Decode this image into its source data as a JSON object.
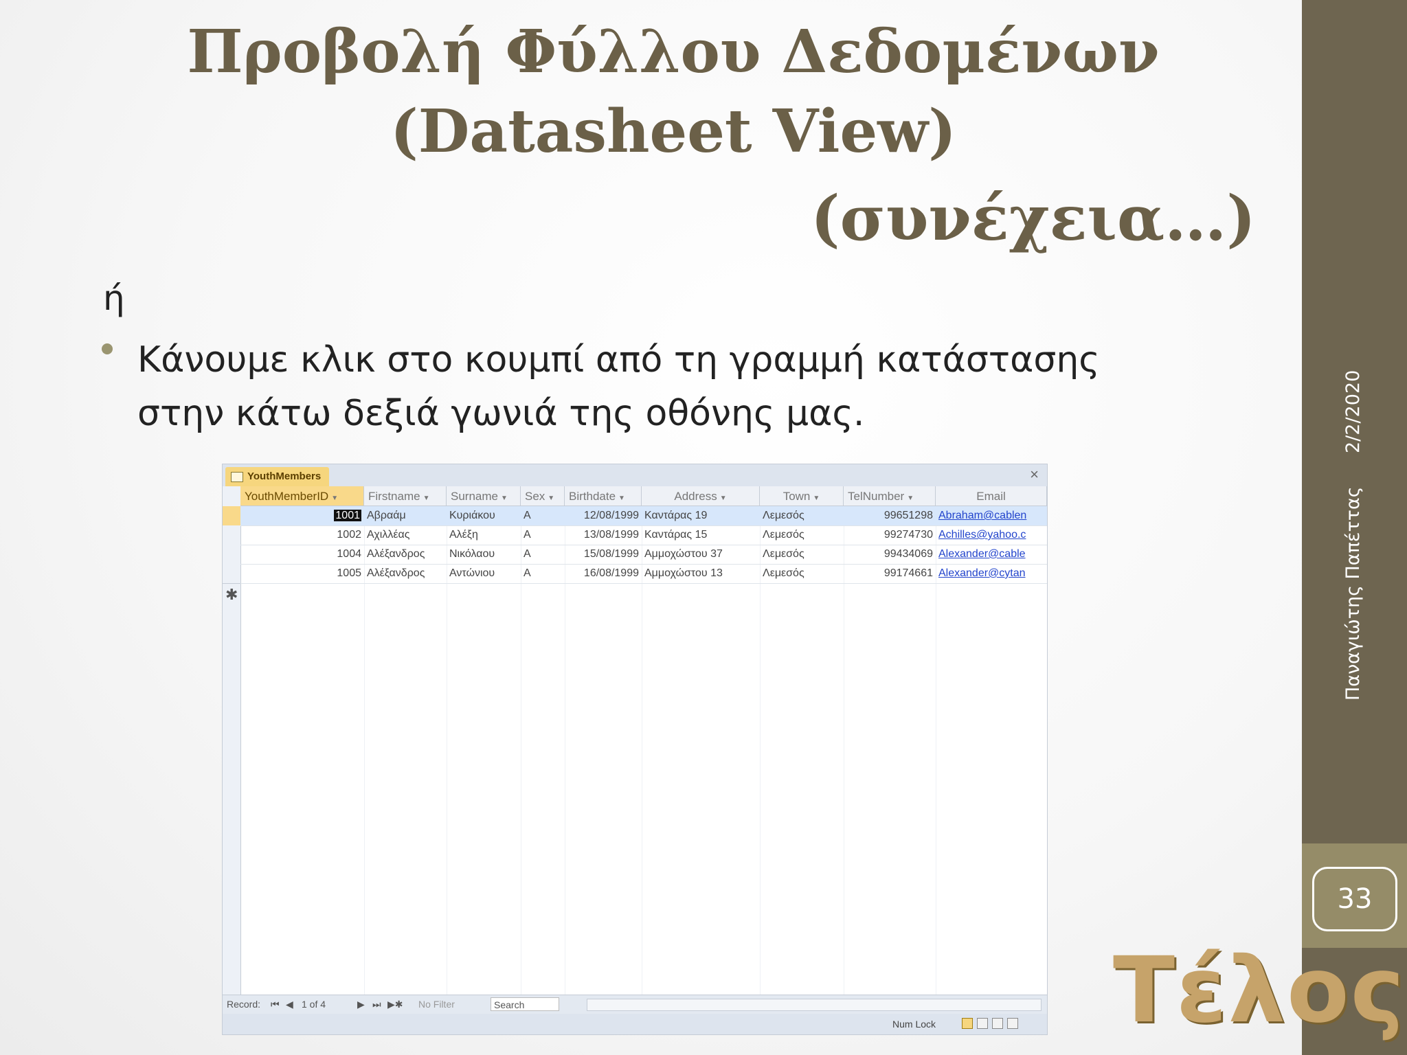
{
  "slide": {
    "title_line1": "Προβολή Φύλλου Δεδομένων",
    "title_line2": "(Datasheet View)",
    "title_line3": "(συνέχεια…)",
    "or_text": "ή",
    "bullet": "Κάνουμε κλικ στο κουμπί από τη γραμμή κατάστασης στην κάτω δεξιά γωνιά της οθόνης μας.",
    "date": "2/2/2020",
    "author": "Παναγιώτης Παπέττας",
    "page_number": "33",
    "end_text": "Τέλος"
  },
  "screenshot": {
    "tab_label": "YouthMembers",
    "close_label": "×",
    "new_row_marker": "✱",
    "columns": [
      "YouthMemberID",
      "Firstname",
      "Surname",
      "Sex",
      "Birthdate",
      "Address",
      "Town",
      "TelNumber",
      "Email"
    ],
    "rows": [
      [
        "1001",
        "Αβραάμ",
        "Κυριάκου",
        "Α",
        "12/08/1999",
        "Καντάρας 19",
        "Λεμεσός",
        "99651298",
        "Abraham@cablen"
      ],
      [
        "1002",
        "Αχιλλέας",
        "Αλέξη",
        "Α",
        "13/08/1999",
        "Καντάρας 15",
        "Λεμεσός",
        "99274730",
        "Achilles@yahoo.c"
      ],
      [
        "1004",
        "Αλέξανδρος",
        "Νικόλαου",
        "Α",
        "15/08/1999",
        "Αμμοχώστου 37",
        "Λεμεσός",
        "99434069",
        "Alexander@cable"
      ],
      [
        "1005",
        "Αλέξανδρος",
        "Αντώνιου",
        "Α",
        "16/08/1999",
        "Αμμοχώστου 13",
        "Λεμεσός",
        "99174661",
        "Alexander@cytan"
      ]
    ],
    "nav": {
      "record_label": "Record:",
      "position": "1 of 4",
      "filter_label": "No Filter",
      "search_label": "Search"
    },
    "status": {
      "num_lock": "Num Lock"
    }
  }
}
